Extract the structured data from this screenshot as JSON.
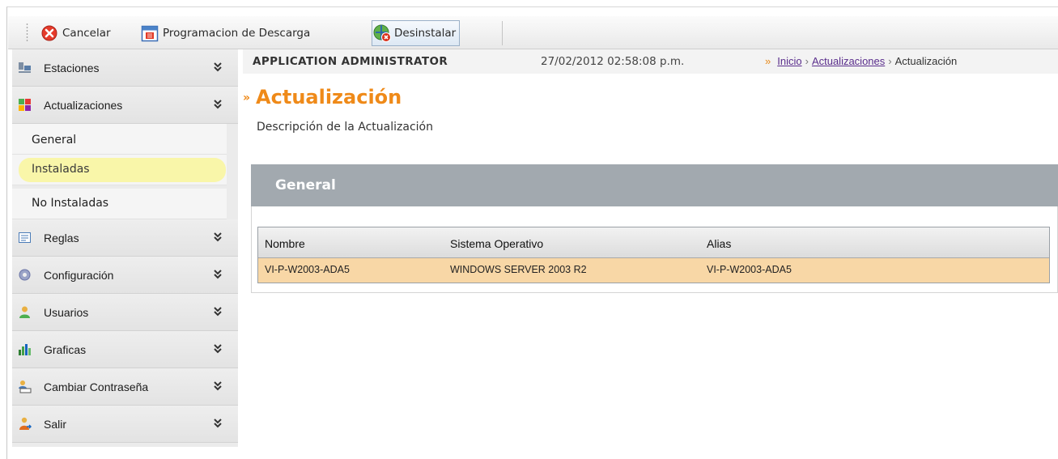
{
  "toolbar": {
    "cancel_label": "Cancelar",
    "schedule_label": "Programacion de Descarga",
    "uninstall_label": "Desinstalar"
  },
  "sidebar": {
    "items": [
      {
        "label": "Estaciones",
        "icon": "stations-icon"
      },
      {
        "label": "Actualizaciones",
        "icon": "updates-icon"
      },
      {
        "label": "Reglas",
        "icon": "rules-icon"
      },
      {
        "label": "Configuración",
        "icon": "settings-icon"
      },
      {
        "label": "Usuarios",
        "icon": "users-icon"
      },
      {
        "label": "Graficas",
        "icon": "charts-icon"
      },
      {
        "label": "Cambiar Contraseña",
        "icon": "change-password-icon"
      },
      {
        "label": "Salir",
        "icon": "logout-icon"
      }
    ],
    "subitems": [
      {
        "label": "General"
      },
      {
        "label": "Instaladas",
        "selected": true
      },
      {
        "label": "No Instaladas"
      }
    ]
  },
  "header": {
    "role": "APPLICATION ADMINISTRATOR",
    "datetime": "27/02/2012 02:58:08 p.m.",
    "breadcrumb": [
      "Inicio",
      "Actualizaciones",
      "Actualización"
    ]
  },
  "main": {
    "title": "Actualización",
    "description": "Descripción de la Actualización",
    "panel_title": "General",
    "table": {
      "columns": [
        "Nombre",
        "Sistema Operativo",
        "Alias"
      ],
      "rows": [
        [
          "VI-P-W2003-ADA5",
          "WINDOWS SERVER 2003 R2",
          "VI-P-W2003-ADA5"
        ]
      ]
    }
  },
  "colors": {
    "accent": "#ef8a19",
    "panel_header": "#a2a9af",
    "selected_row": "#f8d7a6",
    "selected_nav": "#f9f6a9",
    "link": "#5a2e8c"
  }
}
